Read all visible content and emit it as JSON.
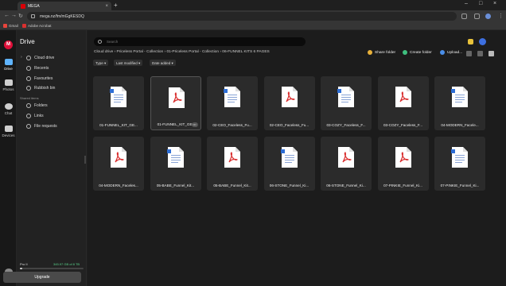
{
  "browser": {
    "tab_title": "MEGA",
    "tab_close": "×",
    "new_tab": "+",
    "url": "mega.nz/fm/mGgKESDQ",
    "bookmarks": [
      {
        "label": "Gmail",
        "color": "#e8453c"
      },
      {
        "label": "Adobe Acrobat",
        "color": "#d9302f"
      }
    ],
    "window_controls": [
      "–",
      "□",
      "×"
    ]
  },
  "rail": {
    "logo": "M",
    "items": [
      {
        "label": "Drive",
        "icon": "drive-icon",
        "active": true
      },
      {
        "label": "Photos",
        "icon": "photos-icon"
      },
      {
        "label": "Chat",
        "icon": "chat-icon"
      },
      {
        "label": "Devices",
        "icon": "devices-icon"
      }
    ]
  },
  "sidebar": {
    "title": "Drive",
    "items": [
      {
        "label": "Cloud drive",
        "icon": "cloud-icon"
      },
      {
        "label": "Recents",
        "icon": "clock-icon"
      },
      {
        "label": "Favourites",
        "icon": "heart-icon"
      },
      {
        "label": "Rubbish bin",
        "icon": "trash-icon"
      }
    ],
    "shared_section": "Shared items",
    "shared_items": [
      {
        "label": "Folders",
        "icon": "folder-icon"
      },
      {
        "label": "Links",
        "icon": "link-icon"
      },
      {
        "label": "File requests",
        "icon": "file-request-icon"
      }
    ],
    "plan": "Pro II",
    "storage_used": "345.97 GB of 8 TB",
    "storage_fraction": 0.04,
    "upgrade_label": "Upgrade"
  },
  "main": {
    "search_placeholder": "Search",
    "breadcrumb": "Cloud drive  ›  Priceless Portal - Collection  ›  01-Priceless Portal - Collection  ›  06-FUNNEL KITS 6 PAGES",
    "actions": {
      "share_folder": "Share folder",
      "create_folder": "Create folder",
      "upload": "Upload..."
    },
    "filters": [
      "Type ▾",
      "Last modified ▾",
      "Date added ▾"
    ],
    "files": [
      {
        "name": "01-FUNNEL_KIT_GE...",
        "type": "doc"
      },
      {
        "name": "01-FUNNEL_KIT_GE...",
        "type": "pdf",
        "selected": true
      },
      {
        "name": "02-CEO_Faceless_Fu...",
        "type": "doc"
      },
      {
        "name": "02-CEO_Faceless_Fu...",
        "type": "pdf"
      },
      {
        "name": "03-COZY_Faceless_F...",
        "type": "doc"
      },
      {
        "name": "03-COZY_Faceless_F...",
        "type": "pdf"
      },
      {
        "name": "04-MODERN_Facele...",
        "type": "doc"
      },
      {
        "name": "04-MODERN_Faceles...",
        "type": "pdf"
      },
      {
        "name": "05-BABE_Funnel_Kit...",
        "type": "doc"
      },
      {
        "name": "05-BABE_Funnel_Kit...",
        "type": "pdf"
      },
      {
        "name": "06-STONE_Funnel_Ki...",
        "type": "doc"
      },
      {
        "name": "06-STONE_Funnel_Ki...",
        "type": "pdf"
      },
      {
        "name": "07-PINKIE_Funnel_Ki...",
        "type": "pdf"
      },
      {
        "name": "07-PINKIE_Funnel_Ki...",
        "type": "doc"
      }
    ],
    "menu_dots": "•••"
  }
}
